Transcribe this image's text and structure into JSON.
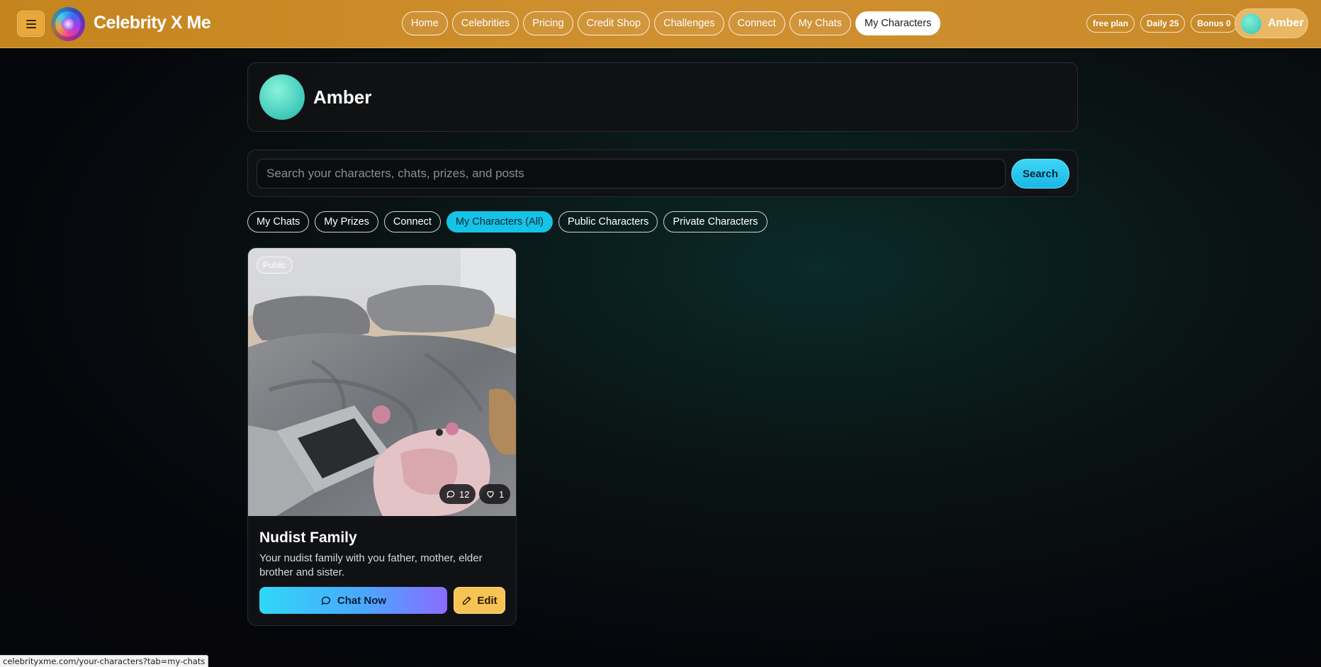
{
  "header": {
    "brand": "Celebrity X Me",
    "nav": [
      "Home",
      "Celebrities",
      "Pricing",
      "Credit Shop",
      "Challenges",
      "Connect",
      "My Chats",
      "My Characters"
    ],
    "active_nav": "My Characters",
    "stats": {
      "plan": "free plan",
      "daily": "Daily 25",
      "bonus": "Bonus 0"
    },
    "user_name": "Amber"
  },
  "profile": {
    "name": "Amber"
  },
  "search": {
    "placeholder": "Search your characters, chats, prizes, and posts",
    "value": "",
    "button": "Search"
  },
  "tabs": [
    "My Chats",
    "My Prizes",
    "Connect",
    "My Characters (All)",
    "Public Characters",
    "Private Characters"
  ],
  "active_tab": "My Characters (All)",
  "characters": [
    {
      "visibility": "Public",
      "chats": "12",
      "likes": "1",
      "title": "Nudist Family",
      "description": "Your nudist family with you father, mother, elder brother and sister.",
      "chat_label": "Chat Now",
      "edit_label": "Edit"
    }
  ],
  "status_url": "celebrityxme.com/your-characters?tab=my-chats",
  "colors": {
    "header": "#c98a2a",
    "accent_cyan": "#16c3e6",
    "edit_yellow": "#f6c454"
  },
  "icons": [
    "menu-icon",
    "logo-icon",
    "chat-bubble-icon",
    "heart-icon",
    "edit-icon"
  ]
}
